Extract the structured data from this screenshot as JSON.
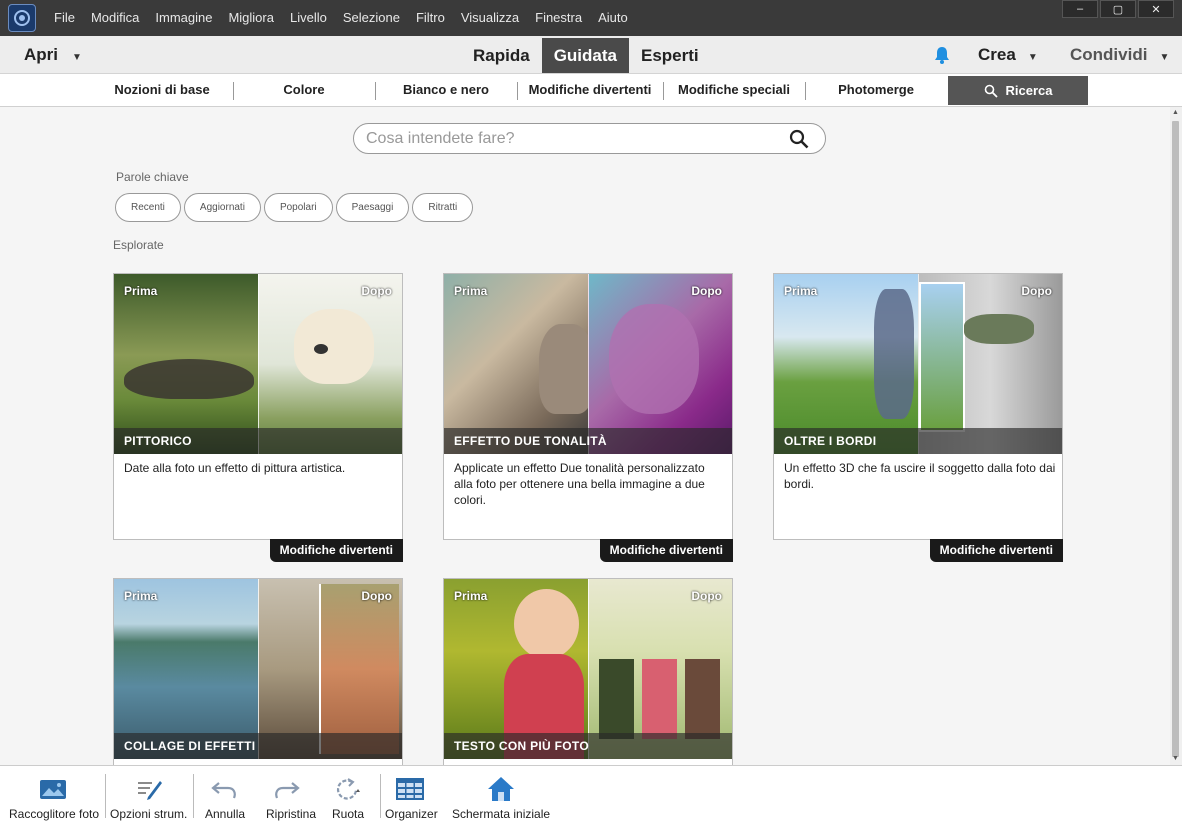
{
  "menu": [
    "File",
    "Modifica",
    "Immagine",
    "Migliora",
    "Livello",
    "Selezione",
    "Filtro",
    "Visualizza",
    "Finestra",
    "Aiuto"
  ],
  "window_controls": [
    "–",
    "▢",
    "✕"
  ],
  "modebar": {
    "open_label": "Apri",
    "modes": [
      "Rapida",
      "Guidata",
      "Esperti"
    ],
    "active_mode": "Guidata",
    "create_label": "Crea",
    "share_label": "Condividi"
  },
  "categories": [
    "Nozioni di base",
    "Colore",
    "Bianco e nero",
    "Modifiche divertenti",
    "Modifiche speciali",
    "Photomerge"
  ],
  "search_tab_label": "Ricerca",
  "search": {
    "placeholder": "Cosa intendete fare?",
    "value": ""
  },
  "keywords": {
    "label": "Parole chiave",
    "chips": [
      "Recenti",
      "Aggiornati",
      "Popolari",
      "Paesaggi",
      "Ritratti"
    ]
  },
  "explore_label": "Esplorate",
  "cards": [
    {
      "before": "Prima",
      "after": "Dopo",
      "title": "PITTORICO",
      "desc": "Date alla foto un effetto di pittura artistica.",
      "tag": "Modifiche divertenti"
    },
    {
      "before": "Prima",
      "after": "Dopo",
      "title": "EFFETTO DUE TONALITÀ",
      "desc": "Applicate un effetto Due tonalità personalizzato alla foto per ottenere una bella immagine a due colori.",
      "tag": "Modifiche divertenti"
    },
    {
      "before": "Prima",
      "after": "Dopo",
      "title": "OLTRE I BORDI",
      "desc": "Un effetto 3D che fa uscire il soggetto dalla foto dai bordi.",
      "tag": "Modifiche divertenti"
    },
    {
      "before": "Prima",
      "after": "Dopo",
      "title": "COLLAGE DI EFFETTI",
      "desc": "",
      "tag": ""
    },
    {
      "before": "Prima",
      "after": "Dopo",
      "title": "TESTO CON PIÙ FOTO",
      "desc": "",
      "tag": ""
    }
  ],
  "bottom_tools": [
    "Raccoglitore foto",
    "Opzioni strum.",
    "Annulla",
    "Ripristina",
    "Ruota",
    "Organizer",
    "Schermata iniziale"
  ],
  "colors": {
    "accent_blue": "#1f8fe0",
    "active_tab": "#4a4a4a",
    "menubar": "#3a3a3a"
  }
}
